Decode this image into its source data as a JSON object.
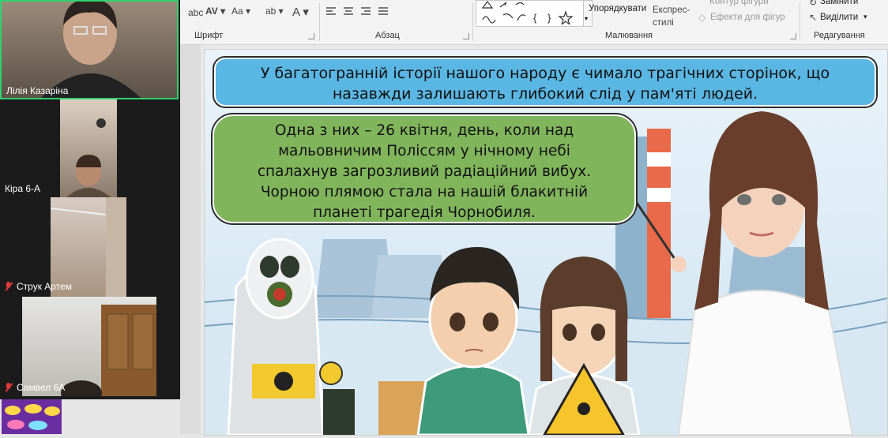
{
  "participants": [
    {
      "name": "Лілія Казаріна",
      "muted": false,
      "active": true
    },
    {
      "name": "Кіра 6-А",
      "muted": false,
      "active": false
    },
    {
      "name": "Струк Артем",
      "muted": true,
      "active": false
    },
    {
      "name": "Самвел 6А",
      "muted": true,
      "active": false
    }
  ],
  "ribbon": {
    "groups": {
      "font": "Шрифт",
      "paragraph": "Абзац",
      "drawing": "Малювання",
      "editing": "Редагування"
    },
    "buttons": {
      "arrange": "Упорядкувати",
      "quick_styles": "Експрес-стилі",
      "shape_outline": "Контур фігури",
      "shape_effects": "Ефекти для фігур",
      "replace": "Замінити",
      "select": "Виділити"
    }
  },
  "slide": {
    "top_text_lines": [
      "У багатогранній історії нашого народу є чимало трагічних сторінок, що",
      "назавжди залишають глибокий слід у пам'яті людей."
    ],
    "mid_text_lines": [
      "Одна з них – 26 квітня, день, коли над",
      "мальовничим Поліссям у нічному небі",
      "спалахнув загрозливий радіаційний вибух.",
      "Чорною плямою стала на нашій блакитній",
      "планеті трагедія Чорнобиля."
    ]
  },
  "colors": {
    "top_bubble": "#5ab6e3",
    "mid_bubble": "#80b55c",
    "active_speaker_border": "#2fd16f",
    "muted_icon": "#e23a3a"
  }
}
